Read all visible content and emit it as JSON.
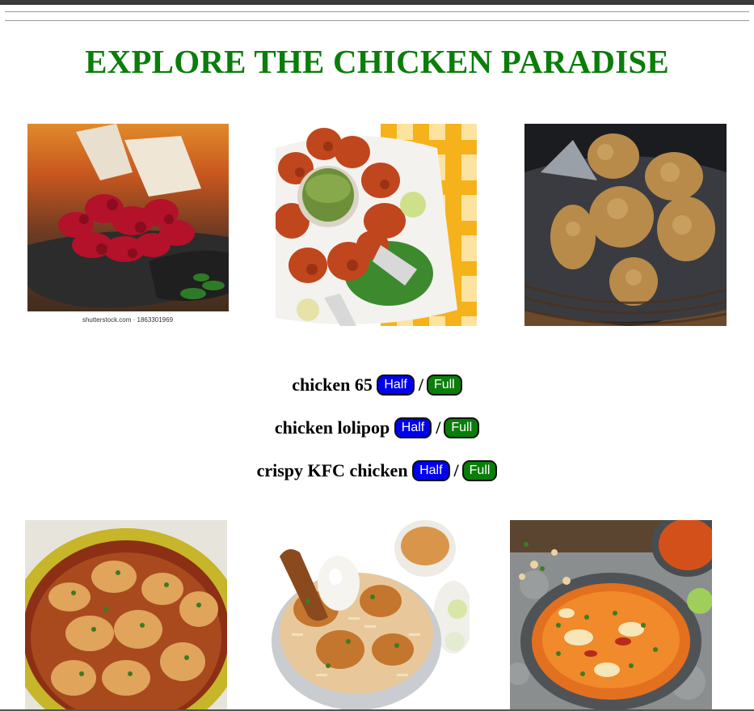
{
  "page": {
    "title": "EXPLORE THE CHICKEN PARADISE",
    "title_color": "#0a7d0a"
  },
  "photos_top": [
    {
      "name": "chicken-65-photo",
      "caption": "shutterstock.com · 1863301969"
    },
    {
      "name": "chicken-lolipop-photo"
    },
    {
      "name": "crispy-kfc-chicken-photo"
    }
  ],
  "menu": [
    {
      "item": "chicken 65",
      "half_label": "Half",
      "full_label": "Full",
      "separator": "/"
    },
    {
      "item": "chicken lolipop",
      "half_label": "Half",
      "full_label": "Full",
      "separator": "/"
    },
    {
      "item": "crispy KFC chicken",
      "half_label": "Half",
      "full_label": "Full",
      "separator": "/"
    }
  ],
  "photos_bottom": [
    {
      "name": "chicken-curry-photo"
    },
    {
      "name": "chicken-biryani-photo"
    },
    {
      "name": "chicken-soup-photo"
    }
  ],
  "colors": {
    "half_button": "#0000ee",
    "full_button": "#0a7d0a"
  }
}
